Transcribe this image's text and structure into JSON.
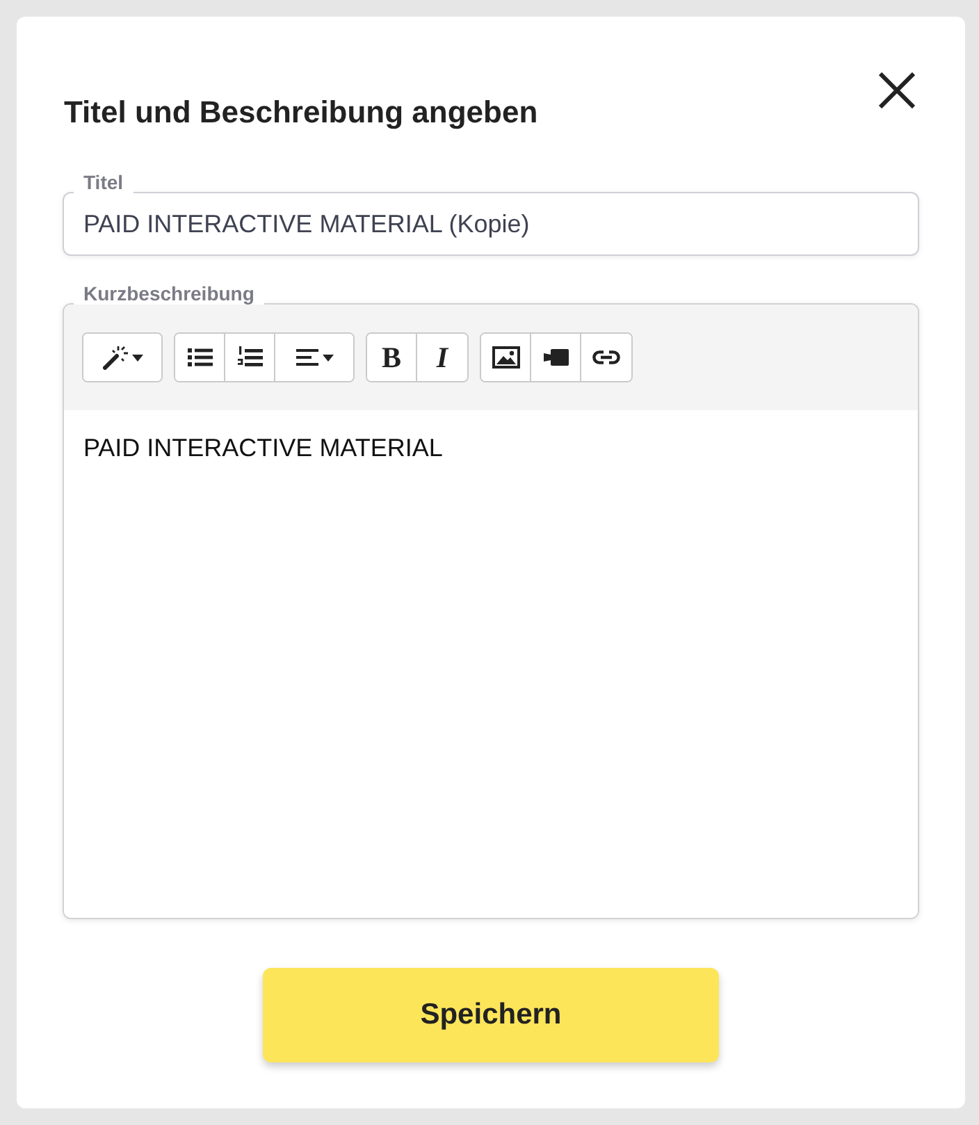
{
  "dialog": {
    "title": "Titel und Beschreibung angeben",
    "title_field": {
      "label": "Titel",
      "value": "PAID INTERACTIVE MATERIAL (Kopie)"
    },
    "description_field": {
      "label": "Kurzbeschreibung",
      "toolbar": [
        [
          {
            "kind": "style"
          }
        ],
        [
          {
            "kind": "bullets"
          },
          {
            "kind": "numbering"
          },
          {
            "kind": "align"
          }
        ],
        [
          {
            "kind": "bold",
            "label": "B"
          },
          {
            "kind": "italic",
            "label": "I"
          }
        ],
        [
          {
            "kind": "picture"
          },
          {
            "kind": "video"
          },
          {
            "kind": "link"
          }
        ]
      ],
      "content": "PAID INTERACTIVE MATERIAL"
    },
    "save_button": "Speichern"
  }
}
